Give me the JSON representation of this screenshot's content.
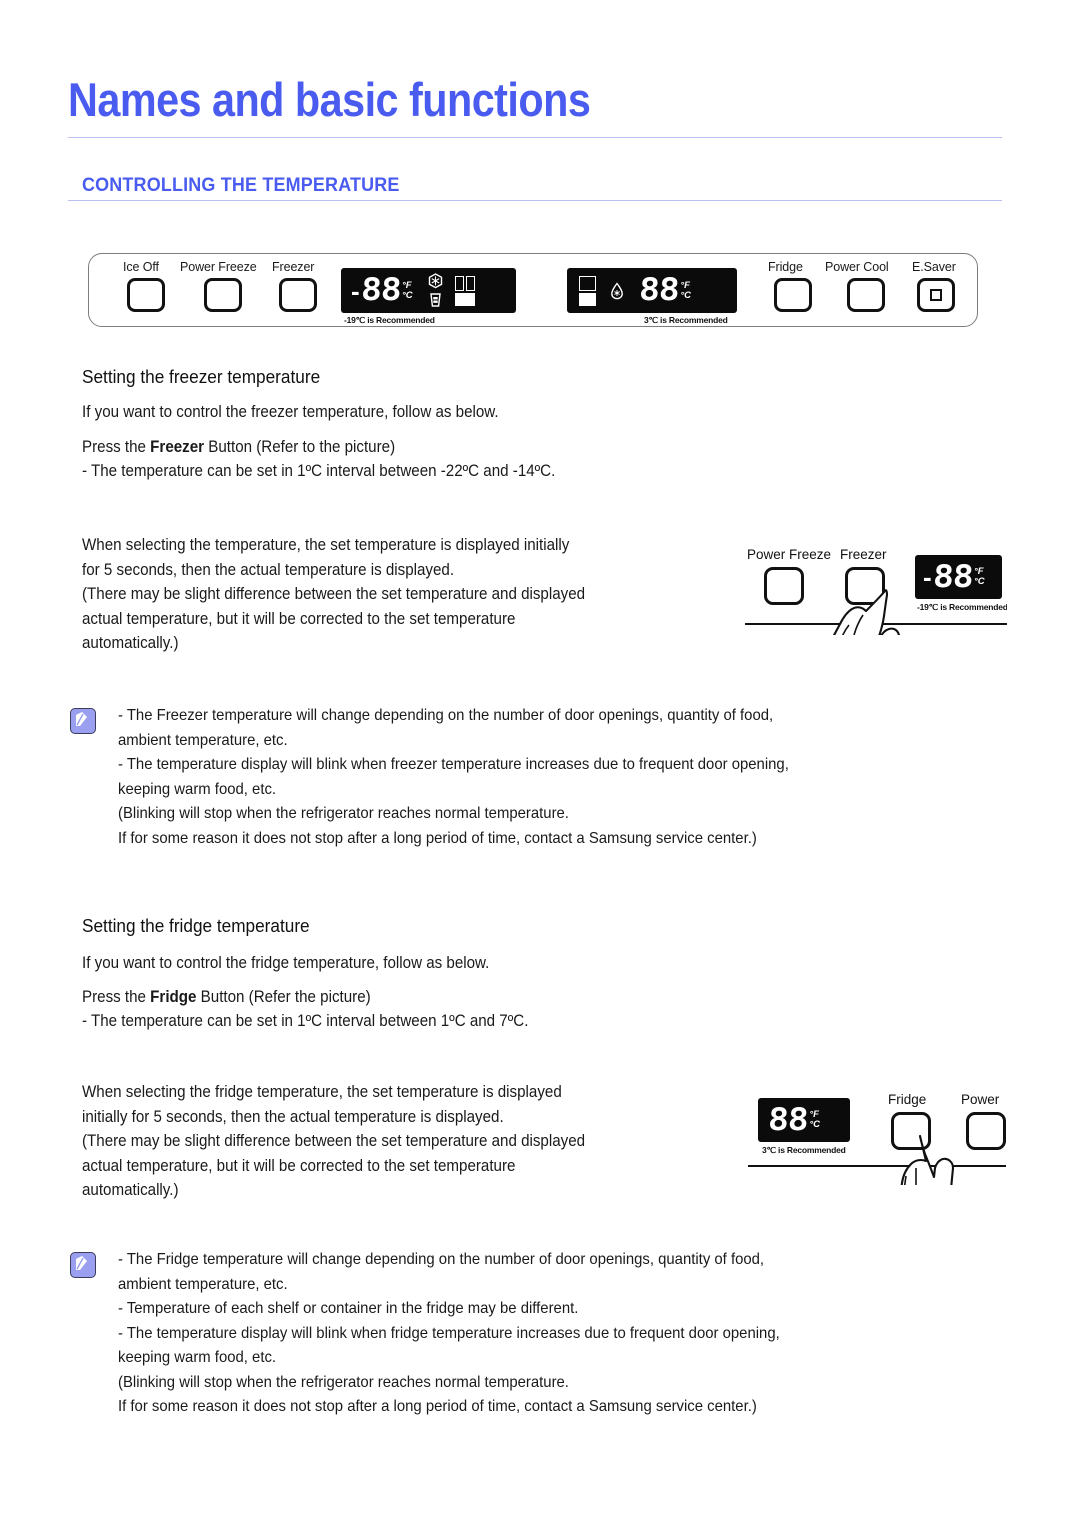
{
  "header": {
    "title": "Names and basic functions",
    "section_title": "CONTROLLING THE TEMPERATURE",
    "title_color": "#4a5cf0",
    "rule_color": "#b9bff0"
  },
  "control_panel": {
    "left_buttons": [
      {
        "label": "Ice Off",
        "name": "ice-off-button"
      },
      {
        "label": "Power Freeze",
        "name": "power-freeze-button"
      },
      {
        "label": "Freezer",
        "name": "freezer-button"
      }
    ],
    "right_buttons": [
      {
        "label": "Fridge",
        "name": "fridge-button"
      },
      {
        "label": "Power Cool",
        "name": "power-cool-button"
      },
      {
        "label": "E.Saver",
        "name": "e-saver-button"
      }
    ],
    "freezer_display": {
      "minus": "-",
      "digits": "88",
      "unit_f": "°F",
      "unit_c": "°C",
      "recommend": "-19℃ is Recommended",
      "icons": [
        "cubed-ice-icon",
        "crushed-ice-icon",
        "fridge-layout-icon"
      ]
    },
    "fridge_display": {
      "digits": "88",
      "unit_f": "°F",
      "unit_c": "°C",
      "recommend": "3℃ is Recommended",
      "icons": [
        "fridge-layout-icon",
        "water-drop-icon"
      ]
    }
  },
  "freezer_section": {
    "heading": "Setting the freezer temperature",
    "intro": "If you want to control the freezer temperature, follow as below.",
    "press_prefix": "Press the ",
    "press_bold": "Freezer",
    "press_suffix": " Button (Refer to the picture)",
    "range_line": "- The temperature can be set in 1ºC interval between -22ºC and -14ºC.",
    "body": "When selecting the temperature, the set temperature is displayed initially\nfor 5 seconds, then the actual temperature is displayed.\n(There may be slight difference between the set temperature and displayed\n actual temperature, but it will be corrected to the set temperature\n automatically.)",
    "note": "- The Freezer temperature will change depending on the number of door openings, quantity of food,\n  ambient temperature, etc.\n - The temperature display will blink when freezer temperature increases due to frequent door opening,\n   keeping warm food, etc.\n   (Blinking will stop when the refrigerator reaches normal temperature.\n    If for some reason it does not stop after a long period of time, contact a Samsung service center.)",
    "figure": {
      "labels": [
        "Power Freeze",
        "Freezer"
      ],
      "display_minus": "-",
      "display_digits": "88",
      "unit_f": "°F",
      "unit_c": "°C",
      "recommend": "-19℃ is Recommended"
    }
  },
  "fridge_section": {
    "heading": "Setting the fridge temperature",
    "intro": "If you want to control the fridge temperature, follow as below.",
    "press_prefix": "Press the ",
    "press_bold": "Fridge",
    "press_suffix": " Button (Refer the picture)",
    "range_line": "- The temperature can be set in 1ºC interval between 1ºC and 7ºC.",
    "body": "When selecting the fridge temperature, the set temperature is displayed\ninitially for 5 seconds, then the actual temperature is displayed.\n(There may be slight difference between the set temperature and displayed\n actual temperature, but it will be corrected to the set temperature\n automatically.)",
    "note": "- The Fridge temperature will change depending on the number of door openings, quantity of food,\n  ambient temperature, etc.\n - Temperature of each shelf or container in the fridge may be different.\n - The temperature display will blink when fridge temperature increases due to frequent door opening,\n   keeping warm food, etc.\n   (Blinking will stop when the refrigerator reaches normal temperature.\n    If for some reason it does not stop after a long period of time, contact a Samsung service center.)",
    "figure": {
      "labels": [
        "Fridge",
        "Power"
      ],
      "display_digits": "88",
      "unit_f": "°F",
      "unit_c": "°C",
      "recommend": "3℃ is Recommended"
    }
  }
}
